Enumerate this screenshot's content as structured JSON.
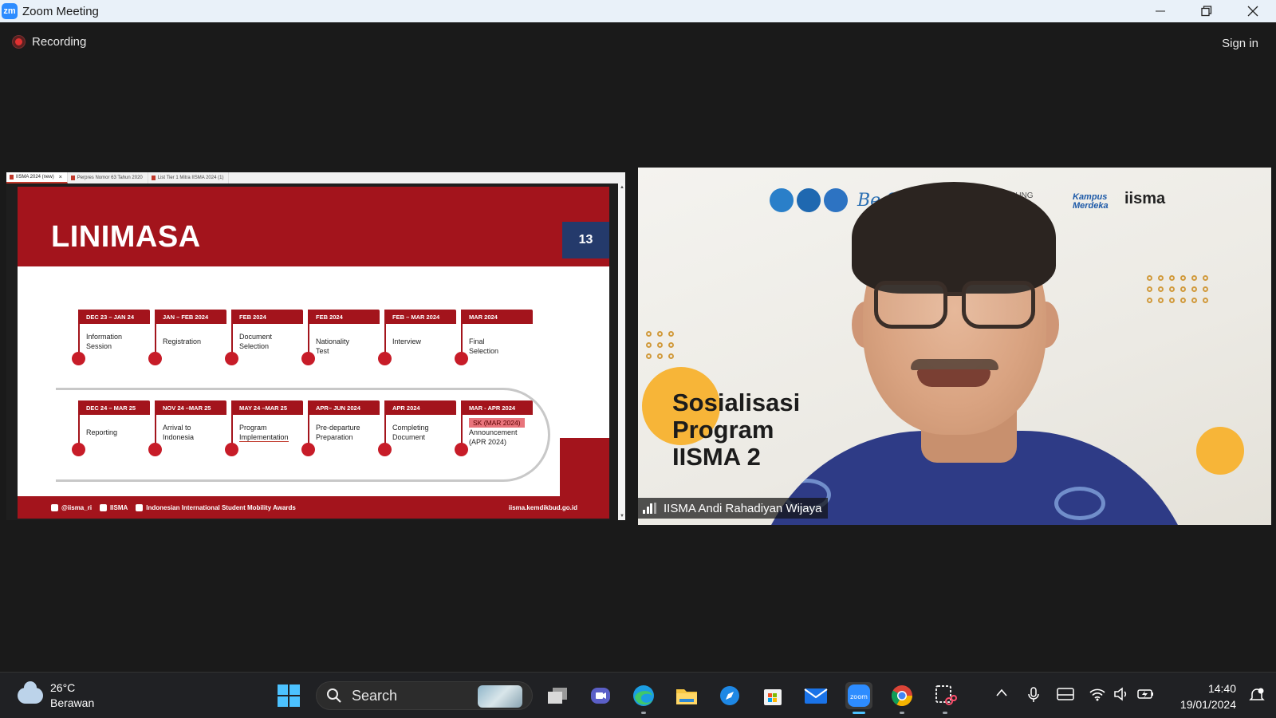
{
  "window": {
    "title": "Zoom Meeting",
    "app_logo_text": "zm"
  },
  "meeting": {
    "recording_label": "Recording",
    "sign_in_label": "Sign in"
  },
  "shared_screen": {
    "tabs": [
      {
        "label": "IISMA 2024 (new)",
        "close": "×"
      },
      {
        "label": "Perpres Nomor 63 Tahun 2020"
      },
      {
        "label": "List Tier 1 Mitra IISMA 2024 (1)"
      }
    ],
    "slide": {
      "title": "LINIMASA",
      "page_number": "13",
      "row1": [
        {
          "date": "DEC 23 – JAN 24",
          "label_line1": "Information",
          "label_line2": "Session"
        },
        {
          "date": "JAN – FEB 2024",
          "label_line1": "Registration",
          "label_line2": ""
        },
        {
          "date": "FEB 2024",
          "label_line1": "Document",
          "label_line2": "Selection"
        },
        {
          "date": "FEB 2024",
          "label_line1": "Nationality",
          "label_line2": "Test"
        },
        {
          "date": "FEB – MAR 2024",
          "label_line1": "Interview",
          "label_line2": ""
        },
        {
          "date": "MAR 2024",
          "label_line1": "Final",
          "label_line2": "Selection"
        }
      ],
      "row2": [
        {
          "date": "DEC 24 – MAR 25",
          "label_line1": "Reporting",
          "label_line2": ""
        },
        {
          "date": "NOV 24 –MAR 25",
          "label_line1": "Arrival to",
          "label_line2": "Indonesia"
        },
        {
          "date": "MAY 24 –MAR 25",
          "label_line1": "Program",
          "label_line2": "Implementation"
        },
        {
          "date": "APR– JUN 2024",
          "label_line1": "Pre-departure",
          "label_line2": "Preparation"
        },
        {
          "date": "APR 2024",
          "label_line1": "Completing",
          "label_line2": "Document"
        },
        {
          "date": "MAR - APR 2024",
          "label_line1": "Announcement",
          "label_line2": "(APR 2024)",
          "highlight": "SK (MAR 2024)"
        }
      ],
      "footer": {
        "instagram": "@iisma_ri",
        "youtube": "IISMA",
        "linkedin": "Indonesian International Student Mobility Awards",
        "website": "iisma.kemdikbud.go.id"
      }
    }
  },
  "video": {
    "participant_name": "IISMA Andi Rahadiyan Wijaya",
    "background_text": {
      "line1": "Sosialisasi",
      "line2": "Program",
      "line3": "IISMA 2",
      "be_text": "Be S",
      "lampung": "AS LAMPUNG",
      "kampus": "Kampus",
      "merdeka": "Merdeka",
      "iisma": "iisma"
    }
  },
  "taskbar": {
    "weather_temp": "26°C",
    "weather_desc": "Berawan",
    "search_label": "Search",
    "time": "14:40",
    "date": "19/01/2024"
  },
  "colors": {
    "slide_red": "#a3141c",
    "slide_navy": "#243a6b",
    "zoom_blue": "#2d8cff",
    "accent_orange": "#f7b538"
  }
}
